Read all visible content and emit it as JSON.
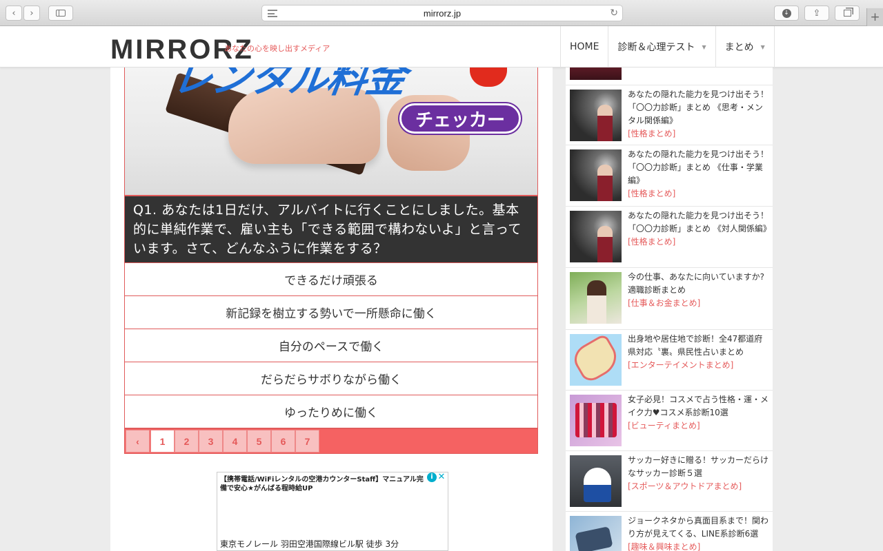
{
  "browser": {
    "url": "mirrorz.jp"
  },
  "site": {
    "logo": "MIRRORZ",
    "tagline": "あなたの心を映し出すメディア",
    "nav": [
      {
        "label": "HOME"
      },
      {
        "label": "診断＆心理テスト"
      },
      {
        "label": "まとめ"
      }
    ]
  },
  "article": {
    "image_title": "レンタル料金",
    "image_badge": "チェッカー",
    "question": "Q1. あなたは1日だけ、アルバイトに行くことにしました。基本的に単純作業で、雇い主も「できる範囲で構わないよ」と言っています。さて、どんなふうに作業をする？",
    "answers": [
      "できるだけ頑張る",
      "新記録を樹立する勢いで一所懸命に働く",
      "自分のペースで働く",
      "だらだらサボりながら働く",
      "ゆったりめに働く"
    ],
    "pager": {
      "prev": "‹",
      "pages": [
        "1",
        "2",
        "3",
        "4",
        "5",
        "6",
        "7"
      ],
      "current": "1"
    }
  },
  "ad": {
    "title": "【携帯電話/WiFiレンタルの空港カウンターStaff】マニュアル完備で安心★がんばる程時給UP",
    "footer": "東京モノレール 羽田空港国際線ビル駅 徒歩 3分",
    "info_icon": "i",
    "close_icon": "✕"
  },
  "sidebar": {
    "items": [
      {
        "title": "あなたの隠れた能力を見つけ出そう！「〇〇力診断」まとめ 《思考・メンタル関係編》",
        "category": "[性格まとめ]",
        "thumb": "th-woman"
      },
      {
        "title": "あなたの隠れた能力を見つけ出そう！「〇〇力診断」まとめ 《仕事・学業編》",
        "category": "[性格まとめ]",
        "thumb": "th-woman"
      },
      {
        "title": "あなたの隠れた能力を見つけ出そう！「〇〇力診断」まとめ 《対人関係編》",
        "category": "[性格まとめ]",
        "thumb": "th-woman"
      },
      {
        "title": "今の仕事、あなたに向いていますか?適職診断まとめ",
        "category": "[仕事＆お金まとめ]",
        "thumb": "th-career"
      },
      {
        "title": "出身地や居住地で診断！全47都道府県対応〝裏〟県民性占いまとめ",
        "category": "[エンターテイメントまとめ]",
        "thumb": "th-map"
      },
      {
        "title": "女子必見！コスメで占う性格・運・メイク力♥コスメ系診断10選",
        "category": "[ビューティまとめ]",
        "thumb": "th-cosme"
      },
      {
        "title": "サッカー好きに贈る！サッカーだらけなサッカー診断５選",
        "category": "[スポーツ＆アウトドアまとめ]",
        "thumb": "th-soccer"
      },
      {
        "title": "ジョークネタから真面目系まで！関わり方が見えてくる、LINE系診断6選",
        "category": "[趣味＆興味まとめ]",
        "thumb": "th-line"
      }
    ]
  },
  "colors": {
    "accent": "#e55a5a",
    "question_bg": "#333333",
    "pager_bg": "#f56262"
  }
}
